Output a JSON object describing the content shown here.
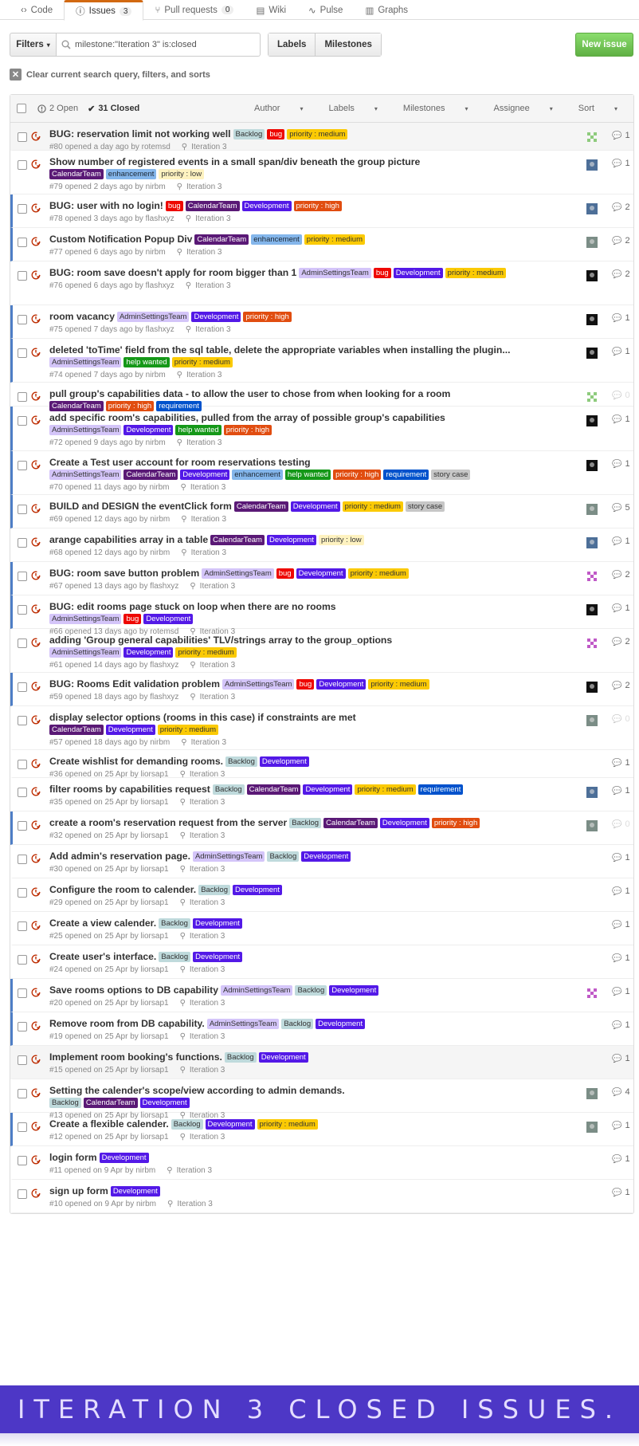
{
  "tabs": [
    {
      "label": "Code",
      "count": "",
      "icon": "code-icon"
    },
    {
      "label": "Issues",
      "count": "3",
      "icon": "issue-icon",
      "active": true
    },
    {
      "label": "Pull requests",
      "count": "0",
      "icon": "pull-request-icon"
    },
    {
      "label": "Wiki",
      "count": "",
      "icon": "book-icon"
    },
    {
      "label": "Pulse",
      "count": "",
      "icon": "pulse-icon"
    },
    {
      "label": "Graphs",
      "count": "",
      "icon": "graph-icon"
    }
  ],
  "toolbar": {
    "filters_label": "Filters",
    "search_value": "milestone:\"Iteration 3\" is:closed",
    "labels_label": "Labels",
    "milestones_label": "Milestones",
    "new_issue_label": "New issue"
  },
  "clear_label": "Clear current search query, filters, and sorts",
  "list_header": {
    "open_label": "2 Open",
    "closed_label": "31 Closed",
    "menus": [
      "Author",
      "Labels",
      "Milestones",
      "Assignee",
      "Sort"
    ]
  },
  "label_colors": {
    "Backlog": {
      "bg": "#bfdadc",
      "fg": "#333"
    },
    "bug": {
      "bg": "#ee0701",
      "fg": "#fff"
    },
    "priority : medium": {
      "bg": "#fbca04",
      "fg": "#333"
    },
    "priority : low": {
      "bg": "#fef2c0",
      "fg": "#333"
    },
    "priority : high": {
      "bg": "#e14d10",
      "fg": "#fff"
    },
    "CalendarTeam": {
      "bg": "#5a1976",
      "fg": "#fff"
    },
    "enhancement": {
      "bg": "#84b6eb",
      "fg": "#1c2733"
    },
    "Development": {
      "bg": "#5319e7",
      "fg": "#fff"
    },
    "AdminSettingsTeam": {
      "bg": "#d4c5f9",
      "fg": "#333"
    },
    "help wanted": {
      "bg": "#159818",
      "fg": "#fff"
    },
    "requirement": {
      "bg": "#0052cc",
      "fg": "#fff"
    },
    "story case": {
      "bg": "#c7c7c7",
      "fg": "#333"
    }
  },
  "issues": [
    {
      "title": "BUG: reservation limit not working well",
      "labels": [
        "Backlog",
        "bug",
        "priority : medium"
      ],
      "meta": "#80 opened a day ago by rotemsd",
      "milestone": "Iteration 3",
      "comments": "1",
      "avatar": "green"
    },
    {
      "title": "Show number of registered events in a small span/div beneath the group picture",
      "labels": [
        "CalendarTeam",
        "enhancement",
        "priority : low"
      ],
      "meta": "#79 opened 2 days ago by nirbm",
      "milestone": "Iteration 3",
      "comments": "1",
      "avatar": "blue"
    },
    {
      "title": "BUG: user with no login!",
      "labels": [
        "bug",
        "CalendarTeam",
        "Development",
        "priority : high"
      ],
      "meta": "#78 opened 3 days ago by flashxyz",
      "milestone": "Iteration 3",
      "comments": "2",
      "avatar": "blue"
    },
    {
      "title": "Custom Notification Popup Div",
      "labels": [
        "CalendarTeam",
        "enhancement",
        "priority : medium"
      ],
      "meta": "#77 opened 6 days ago by nirbm",
      "milestone": "Iteration 3",
      "comments": "2",
      "avatar": "gray"
    },
    {
      "title": "BUG: room save doesn't apply for room bigger than 1",
      "labels": [
        "AdminSettingsTeam",
        "bug",
        "Development",
        "priority : medium"
      ],
      "meta": "#76 opened 6 days ago by flashxyz",
      "milestone": "Iteration 3",
      "comments": "2",
      "avatar": "dark"
    },
    {
      "title": "room vacancy",
      "labels": [
        "AdminSettingsTeam",
        "Development",
        "priority : high"
      ],
      "meta": "#75 opened 7 days ago by flashxyz",
      "milestone": "Iteration 3",
      "comments": "1",
      "avatar": "dark"
    },
    {
      "title": "deleted 'toTime' field from the sql table, delete the appropriate variables when installing the plugin...",
      "labels": [
        "AdminSettingsTeam",
        "help wanted",
        "priority : medium"
      ],
      "meta": "#74 opened 7 days ago by nirbm",
      "milestone": "Iteration 3",
      "comments": "1",
      "avatar": "dark"
    },
    {
      "title": "pull group's capabilities data - to allow the user to chose from when looking for a room",
      "labels": [
        "CalendarTeam",
        "priority : high",
        "requirement"
      ],
      "meta": "",
      "milestone": "",
      "comments": "0",
      "avatar": "green"
    },
    {
      "title": "add specific room's capabilities, pulled from the array of possible group's capabilities",
      "labels": [
        "AdminSettingsTeam",
        "Development",
        "help wanted",
        "priority : high"
      ],
      "meta": "#72 opened 9 days ago by nirbm",
      "milestone": "Iteration 3",
      "comments": "1",
      "avatar": "dark"
    },
    {
      "title": "Create a Test user account for room reservations testing",
      "labels": [
        "AdminSettingsTeam",
        "CalendarTeam",
        "Development",
        "enhancement",
        "help wanted",
        "priority : high",
        "requirement",
        "story case"
      ],
      "meta": "#70 opened 11 days ago by nirbm",
      "milestone": "Iteration 3",
      "comments": "1",
      "avatar": "dark"
    },
    {
      "title": "BUILD and DESIGN the eventClick form",
      "labels": [
        "CalendarTeam",
        "Development",
        "priority : medium",
        "story case"
      ],
      "meta": "#69 opened 12 days ago by nirbm",
      "milestone": "Iteration 3",
      "comments": "5",
      "avatar": "gray"
    },
    {
      "title": "arange capabilities array in a table",
      "labels": [
        "CalendarTeam",
        "Development",
        "priority : low"
      ],
      "meta": "#68 opened 12 days ago by nirbm",
      "milestone": "Iteration 3",
      "comments": "1",
      "avatar": "blue"
    },
    {
      "title": "BUG: room save button problem",
      "labels": [
        "AdminSettingsTeam",
        "bug",
        "Development",
        "priority : medium"
      ],
      "meta": "#67 opened 13 days ago by flashxyz",
      "milestone": "Iteration 3",
      "comments": "2",
      "avatar": "pink"
    },
    {
      "title": "BUG: edit rooms page stuck on loop when there are no rooms",
      "labels": [
        "AdminSettingsTeam",
        "bug",
        "Development"
      ],
      "meta": "#66 opened 13 days ago by rotemsd",
      "milestone": "Iteration 3",
      "comments": "1",
      "avatar": "dark"
    },
    {
      "title": "adding 'Group general capabilities' TLV/strings array to the group_options",
      "labels": [
        "AdminSettingsTeam",
        "Development",
        "priority : medium"
      ],
      "meta": "#61 opened 14 days ago by flashxyz",
      "milestone": "Iteration 3",
      "comments": "2",
      "avatar": "pink"
    },
    {
      "title": "BUG: Rooms Edit validation problem",
      "labels": [
        "AdminSettingsTeam",
        "bug",
        "Development",
        "priority : medium"
      ],
      "meta": "#59 opened 18 days ago by flashxyz",
      "milestone": "Iteration 3",
      "comments": "2",
      "avatar": "dark"
    },
    {
      "title": "display selector options (rooms in this case) if constraints are met",
      "labels": [
        "CalendarTeam",
        "Development",
        "priority : medium"
      ],
      "meta": "#57 opened 18 days ago by nirbm",
      "milestone": "Iteration 3",
      "comments": "0",
      "avatar": "gray"
    },
    {
      "title": "Create wishlist for demanding rooms.",
      "labels": [
        "Backlog",
        "Development"
      ],
      "meta": "#36 opened on 25 Apr by liorsap1",
      "milestone": "Iteration 3",
      "comments": "1",
      "avatar": ""
    },
    {
      "title": "filter rooms by capabilities request",
      "labels": [
        "Backlog",
        "CalendarTeam",
        "Development",
        "priority : medium",
        "requirement"
      ],
      "meta": "#35 opened on 25 Apr by liorsap1",
      "milestone": "Iteration 3",
      "comments": "1",
      "avatar": "blue"
    },
    {
      "title": "create a room's reservation request from the server",
      "labels": [
        "Backlog",
        "CalendarTeam",
        "Development",
        "priority : high"
      ],
      "meta": "#32 opened on 25 Apr by liorsap1",
      "milestone": "Iteration 3",
      "comments": "0",
      "avatar": "gray"
    },
    {
      "title": "Add admin's reservation page.",
      "labels": [
        "AdminSettingsTeam",
        "Backlog",
        "Development"
      ],
      "meta": "#30 opened on 25 Apr by liorsap1",
      "milestone": "Iteration 3",
      "comments": "1",
      "avatar": ""
    },
    {
      "title": "Configure the room to calender.",
      "labels": [
        "Backlog",
        "Development"
      ],
      "meta": "#29 opened on 25 Apr by liorsap1",
      "milestone": "Iteration 3",
      "comments": "1",
      "avatar": ""
    },
    {
      "title": "Create a view calender.",
      "labels": [
        "Backlog",
        "Development"
      ],
      "meta": "#25 opened on 25 Apr by liorsap1",
      "milestone": "Iteration 3",
      "comments": "1",
      "avatar": ""
    },
    {
      "title": "Create user's interface.",
      "labels": [
        "Backlog",
        "Development"
      ],
      "meta": "#24 opened on 25 Apr by liorsap1",
      "milestone": "Iteration 3",
      "comments": "1",
      "avatar": ""
    },
    {
      "title": "Save rooms options to DB capability",
      "labels": [
        "AdminSettingsTeam",
        "Backlog",
        "Development"
      ],
      "meta": "#20 opened on 25 Apr by liorsap1",
      "milestone": "Iteration 3",
      "comments": "1",
      "avatar": "pink"
    },
    {
      "title": "Remove room from DB capability.",
      "labels": [
        "AdminSettingsTeam",
        "Backlog",
        "Development"
      ],
      "meta": "#19 opened on 25 Apr by liorsap1",
      "milestone": "Iteration 3",
      "comments": "1",
      "avatar": ""
    },
    {
      "title": "Implement room booking's functions.",
      "labels": [
        "Backlog",
        "Development"
      ],
      "meta": "#15 opened on 25 Apr by liorsap1",
      "milestone": "Iteration 3",
      "comments": "1",
      "avatar": ""
    },
    {
      "title": "Setting the calender's scope/view according to admin demands.",
      "labels": [
        "Backlog",
        "CalendarTeam",
        "Development"
      ],
      "meta": "#13 opened on 25 Apr by liorsap1",
      "milestone": "Iteration 3",
      "comments": "4",
      "avatar": "gray"
    },
    {
      "title": "Create a flexible calender.",
      "labels": [
        "Backlog",
        "Development",
        "priority : medium"
      ],
      "meta": "#12 opened on 25 Apr by liorsap1",
      "milestone": "Iteration 3",
      "comments": "1",
      "avatar": "gray"
    },
    {
      "title": "login form",
      "labels": [
        "Development"
      ],
      "meta": "#11 opened on 9 Apr by nirbm",
      "milestone": "Iteration 3",
      "comments": "1",
      "avatar": ""
    },
    {
      "title": "sign up form",
      "labels": [
        "Development"
      ],
      "meta": "#10 opened on 9 Apr by nirbm",
      "milestone": "Iteration 3",
      "comments": "1",
      "avatar": ""
    }
  ],
  "banner_text": "ITERATION 3 CLOSED ISSUES."
}
